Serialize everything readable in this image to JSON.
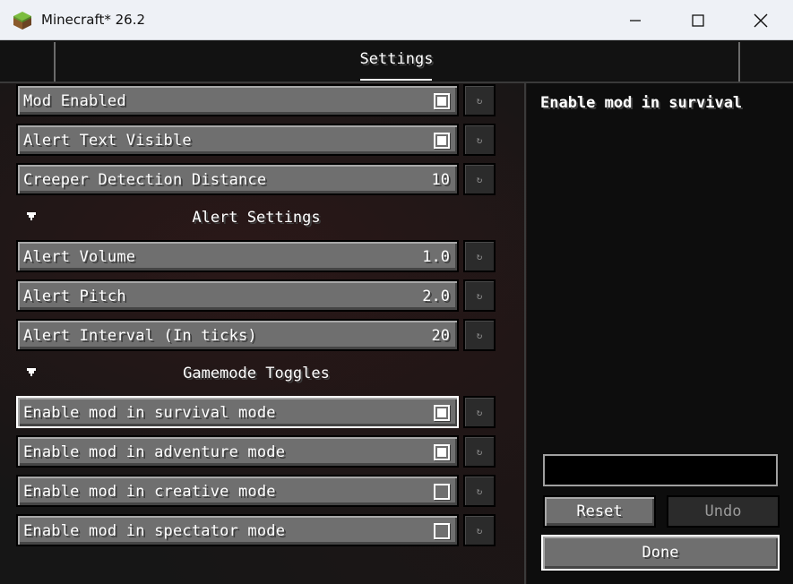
{
  "window": {
    "title": "Minecraft* 26.2",
    "minimize_icon": "minimize-icon",
    "maximize_icon": "maximize-icon",
    "close_icon": "close-icon"
  },
  "header": {
    "tab_label": "Settings"
  },
  "settings": {
    "mod_enabled": {
      "label": "Mod Enabled",
      "checked": true
    },
    "alert_text_visible": {
      "label": "Alert Text Visible",
      "checked": true
    },
    "creeper_distance": {
      "label": "Creeper Detection Distance",
      "value": "10"
    },
    "alert_section": {
      "title": "Alert Settings"
    },
    "alert_volume": {
      "label": "Alert Volume",
      "value": "1.0"
    },
    "alert_pitch": {
      "label": "Alert Pitch",
      "value": "2.0"
    },
    "alert_interval": {
      "label": "Alert Interval (In ticks)",
      "value": "20"
    },
    "gamemode_section": {
      "title": "Gamemode Toggles"
    },
    "survival": {
      "label": "Enable mod in survival mode",
      "checked": true
    },
    "adventure": {
      "label": "Enable mod in adventure mode",
      "checked": true
    },
    "creative": {
      "label": "Enable mod in creative mode",
      "checked": false
    },
    "spectator": {
      "label": "Enable mod in spectator mode",
      "checked": false
    },
    "reset_glyph": "↻"
  },
  "side_panel": {
    "description_title": "Enable mod in survival",
    "search_value": "",
    "reset_label": "Reset",
    "undo_label": "Undo",
    "done_label": "Done"
  },
  "colors": {
    "button_face": "#6f6f6f",
    "focus_border": "#ffffff",
    "panel_bg": "#0d0d0d"
  }
}
